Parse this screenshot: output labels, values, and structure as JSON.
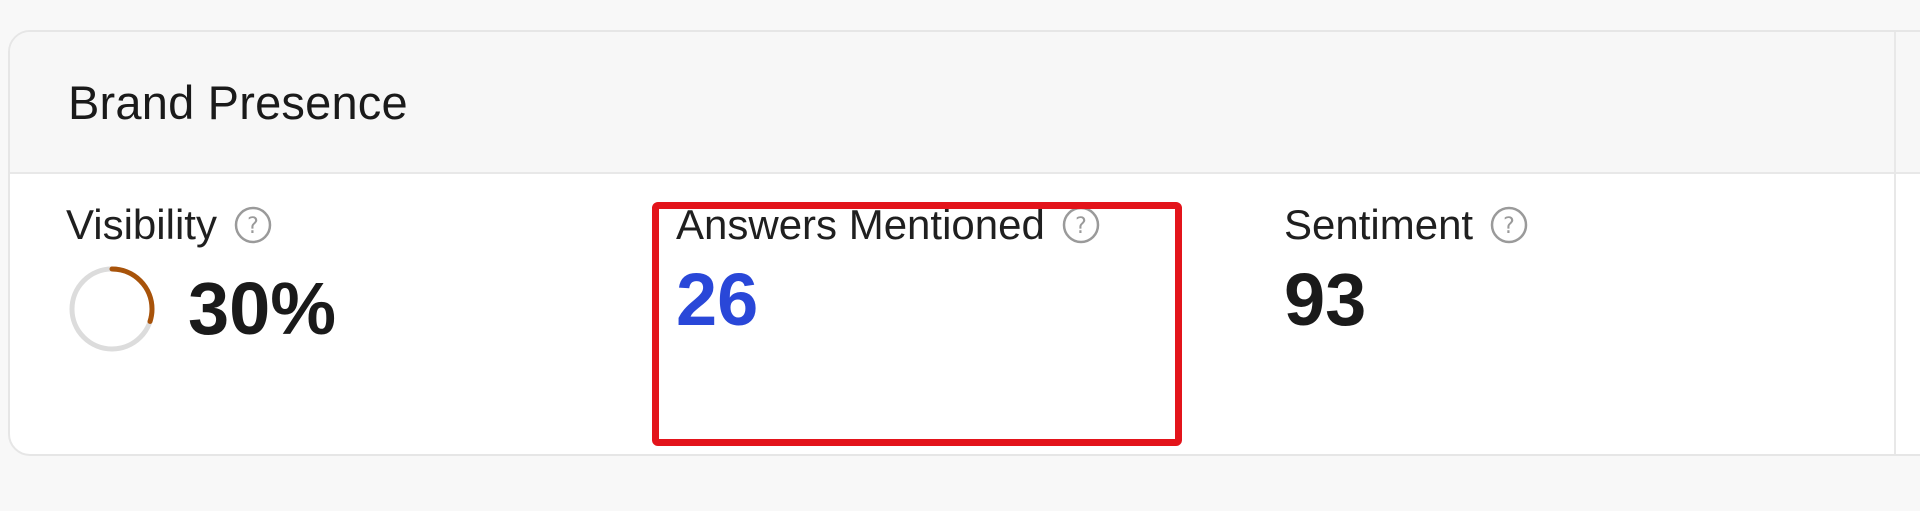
{
  "card": {
    "title": "Brand Presence"
  },
  "metrics": {
    "visibility": {
      "label": "Visibility",
      "value": "30%",
      "ring_fraction": 0.3,
      "ring_color": "#a8530a"
    },
    "answers_mentioned": {
      "label": "Answers Mentioned",
      "value": "26",
      "value_color": "#2947d8"
    },
    "sentiment": {
      "label": "Sentiment",
      "value": "93"
    }
  },
  "icons": {
    "help": "question-circle-icon"
  },
  "colors": {
    "highlight": "#e3141b",
    "accent_blue": "#2947d8"
  }
}
